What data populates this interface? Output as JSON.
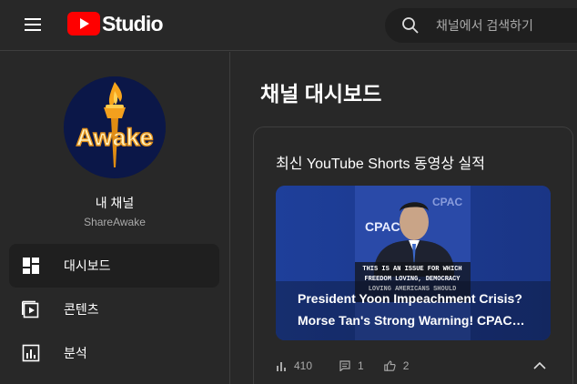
{
  "header": {
    "logo_text": "Studio",
    "search_placeholder": "채널에서 검색하기",
    "brand_color": "#ff0000"
  },
  "sidebar": {
    "avatar_text": "Awake",
    "channel_title": "내 채널",
    "channel_name": "ShareAwake",
    "items": [
      {
        "label": "대시보드",
        "icon": "dashboard-icon",
        "active": true
      },
      {
        "label": "콘텐츠",
        "icon": "content-icon",
        "active": false
      },
      {
        "label": "분석",
        "icon": "analytics-icon",
        "active": false
      }
    ]
  },
  "main": {
    "page_title": "채널 대시보드",
    "card": {
      "title": "최신 YouTube Shorts 동영상 실적",
      "thumbnail": {
        "caption_lines": [
          "THIS IS AN ISSUE FOR WHICH",
          "FREEDOM LOVING, DEMOCRACY",
          "LOVING AMERICANS SHOULD"
        ],
        "backdrop_text": "CPAC"
      },
      "video_title": "President Yoon Impeachment Crisis? Morse Tan's Strong Warning! CPAC…",
      "stats": {
        "views": "410",
        "comments": "1",
        "likes": "2"
      }
    }
  }
}
